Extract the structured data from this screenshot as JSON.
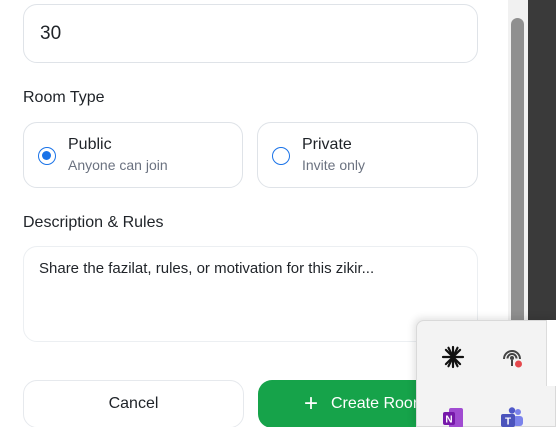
{
  "form": {
    "count_value": "30",
    "room_type_label": "Room Type",
    "room_types": [
      {
        "title": "Public",
        "subtitle": "Anyone can join",
        "selected": true
      },
      {
        "title": "Private",
        "subtitle": "Invite only",
        "selected": false
      }
    ],
    "description_label": "Description & Rules",
    "description_placeholder": "Share the fazilat, rules, or motivation for this zikir...",
    "cancel_label": "Cancel",
    "create_label": "Create Room",
    "accent_color": "#1a73e8",
    "create_color": "#16a34a"
  },
  "tray": {
    "icons": [
      "spark-icon",
      "podcast-icon",
      "onenote-icon",
      "teams-icon"
    ]
  }
}
